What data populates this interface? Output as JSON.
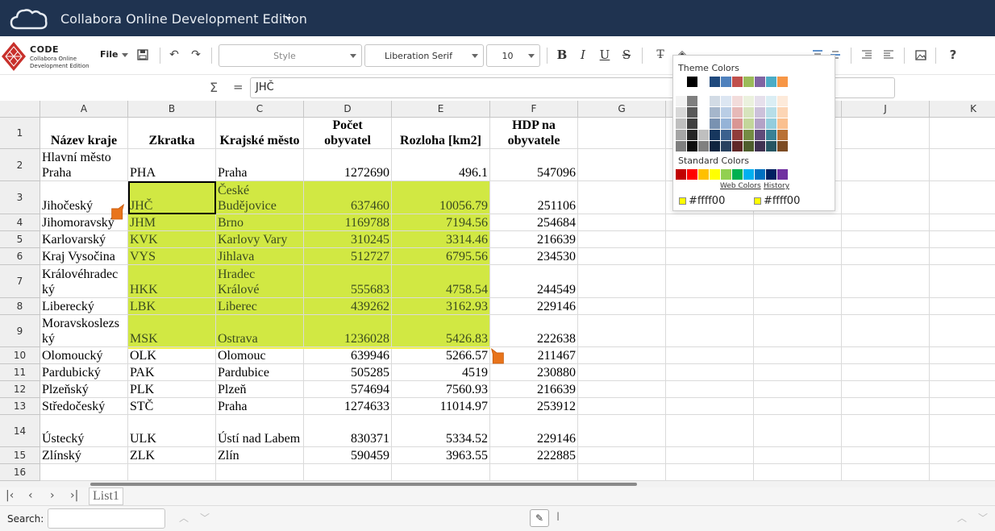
{
  "app": {
    "title": "Collabora Online Development Edition",
    "logo": {
      "name": "CODE",
      "line1": "Collabora Online",
      "line2": "Development Edition"
    }
  },
  "toolbar": {
    "file_label": "File",
    "style_placeholder": "Style",
    "font_name": "Liberation Serif",
    "font_size": "10",
    "help_label": "?"
  },
  "formula": {
    "sigma": "Σ",
    "equals": "=",
    "value": "JHČ"
  },
  "columns": [
    "A",
    "B",
    "C",
    "D",
    "E",
    "F",
    "G",
    "H",
    "I",
    "J",
    "K"
  ],
  "rows": [
    "1",
    "2",
    "3",
    "4",
    "5",
    "6",
    "7",
    "8",
    "9",
    "10",
    "11",
    "12",
    "13",
    "14",
    "15",
    "16"
  ],
  "header": [
    "Název kraje",
    "Zkratka",
    "Krajské město",
    "Počet\nobyvatel",
    "Rozloha [km2]",
    "HDP na\nobyvatele"
  ],
  "table": [
    [
      "Hlavní město\nPraha",
      "PHA",
      "Praha",
      "1272690",
      "496.1",
      "547096"
    ],
    [
      "Jihočeský",
      "JHČ",
      "České\nBudějovice",
      "637460",
      "10056.79",
      "251106"
    ],
    [
      "Jihomoravský",
      "JHM",
      "Brno",
      "1169788",
      "7194.56",
      "254684"
    ],
    [
      "Karlovarský",
      "KVK",
      "Karlovy Vary",
      "310245",
      "3314.46",
      "216639"
    ],
    [
      "Kraj Vysočina",
      "VYS",
      "Jihlava",
      "512727",
      "6795.56",
      "234530"
    ],
    [
      "Královéhradec\nký",
      "HKK",
      "Hradec\nKrálové",
      "555683",
      "4758.54",
      "244549"
    ],
    [
      "Liberecký",
      "LBK",
      "Liberec",
      "439262",
      "3162.93",
      "229146"
    ],
    [
      "Moravskoslezs\nký",
      "MSK",
      "Ostrava",
      "1236028",
      "5426.83",
      "222638"
    ],
    [
      "Olomoucký",
      "OLK",
      "Olomouc",
      "639946",
      "5266.57",
      "211467"
    ],
    [
      "Pardubický",
      "PAK",
      "Pardubice",
      "505285",
      "4519",
      "230880"
    ],
    [
      "Plzeňský",
      "PLK",
      "Plzeň",
      "574694",
      "7560.93",
      "216639"
    ],
    [
      "Středočeský",
      "STČ",
      "Praha",
      "1274633",
      "11014.97",
      "253912"
    ],
    [
      "Ústecký",
      "ULK",
      "Ústí nad Labem",
      "830371",
      "5334.52",
      "229146"
    ],
    [
      "Zlínský",
      "ZLK",
      "Zlín",
      "590459",
      "3963.55",
      "222885"
    ]
  ],
  "sheet_tab": "List1",
  "search": {
    "label": "Search:"
  },
  "color_popup": {
    "theme_title": "Theme Colors",
    "standard_title": "Standard Colors",
    "web_colors_link": "Web Colors",
    "history_link": "History",
    "recent_left": "#ffff00",
    "recent_right": "#ffff00",
    "theme_top": [
      "#000000",
      "#ffffff",
      "#1f497d",
      "#4f81bd",
      "#c0504d",
      "#9bbb59",
      "#8064a2",
      "#4bacc6",
      "#f79646"
    ],
    "standard": [
      "#c00000",
      "#ff0000",
      "#ffc000",
      "#ffff00",
      "#92d050",
      "#00b050",
      "#00b0f0",
      "#0070c0",
      "#002060",
      "#7030a0"
    ],
    "highlight_color": "#d1e843"
  }
}
